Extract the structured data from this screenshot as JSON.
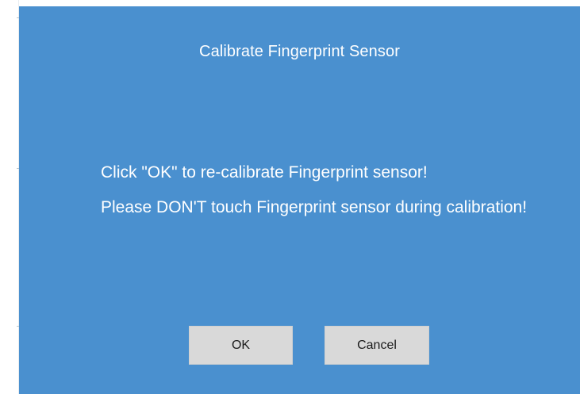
{
  "dialog": {
    "title": "Calibrate Fingerprint Sensor",
    "message_line1": "Click \"OK\" to re-calibrate Fingerprint sensor!",
    "message_line2": "Please DON'T touch Fingerprint sensor during calibration!",
    "ok_label": "OK",
    "cancel_label": "Cancel"
  },
  "colors": {
    "dialog_background": "#4a90cf",
    "button_background": "#d9d9d9",
    "text_on_dialog": "#ffffff"
  }
}
